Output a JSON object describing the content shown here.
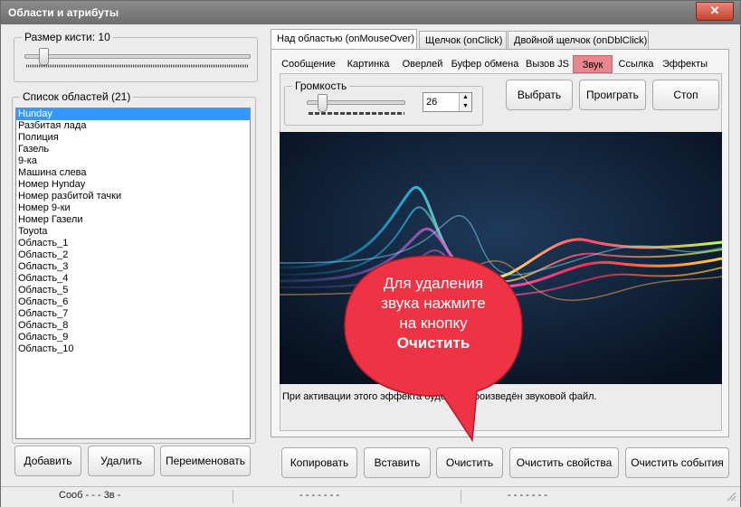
{
  "window": {
    "title": "Области и атрибуты",
    "close_glyph": "✕"
  },
  "brush": {
    "label": "Размер кисти:",
    "value": 10,
    "slider_fraction": 0.08
  },
  "areas": {
    "label": "Список областей (21)",
    "items": [
      "Hunday",
      "Разбитая лада",
      "Полиция",
      "Газель",
      "9-ка",
      "Машина слева",
      "Номер Hynday",
      "Номер разбитой тачки",
      "Номер 9-ки",
      "Номер Газели",
      "Toyota",
      "Область_1",
      "Область_2",
      "Область_3",
      "Область_4",
      "Область_5",
      "Область_6",
      "Область_7",
      "Область_8",
      "Область_9",
      "Область_10"
    ],
    "selected_index": 0
  },
  "left_buttons": {
    "add": "Добавить",
    "delete": "Удалить",
    "rename": "Переименовать"
  },
  "event_tabs": [
    "Над областью (onMouseOver)",
    "Щелчок (onClick)",
    "Двойной щелчок (onDblClick)"
  ],
  "active_event_tab": 0,
  "effect_tabs": [
    "Сообщение",
    "Картинка",
    "Оверлей",
    "Буфер обмена",
    "Вызов JS",
    "Звук",
    "Ссылка",
    "Эффекты"
  ],
  "active_effect_tab": 5,
  "volume": {
    "label": "Громкость",
    "value": "26",
    "slider_fraction": 0.15,
    "spin_up": "▲",
    "spin_down": "▼"
  },
  "sound_buttons": {
    "choose": "Выбрать",
    "play": "Проиграть",
    "stop": "Стоп"
  },
  "info_text": "При активации этого эффекта будет воспроизведён звуковой файл.",
  "callout": {
    "line1": "Для удаления",
    "line2": "звука нажмите",
    "line3": "на кнопку",
    "bold": "Очистить"
  },
  "bottom_buttons": {
    "copy": "Копировать",
    "paste": "Вставить",
    "clear": "Очистить",
    "clear_props": "Очистить свойства",
    "clear_events": "Очистить события"
  },
  "statusbar": {
    "left": "Сооб  -  -  -  3в  -",
    "mid": "-  -  -  -  -  -  -",
    "right": "-  -  -  -  -  -  -"
  },
  "colors": {
    "selection": "#3399ff",
    "active_tab": "#e7868c",
    "callout": "#ee3344",
    "titlebar": "#7c7c7c"
  }
}
